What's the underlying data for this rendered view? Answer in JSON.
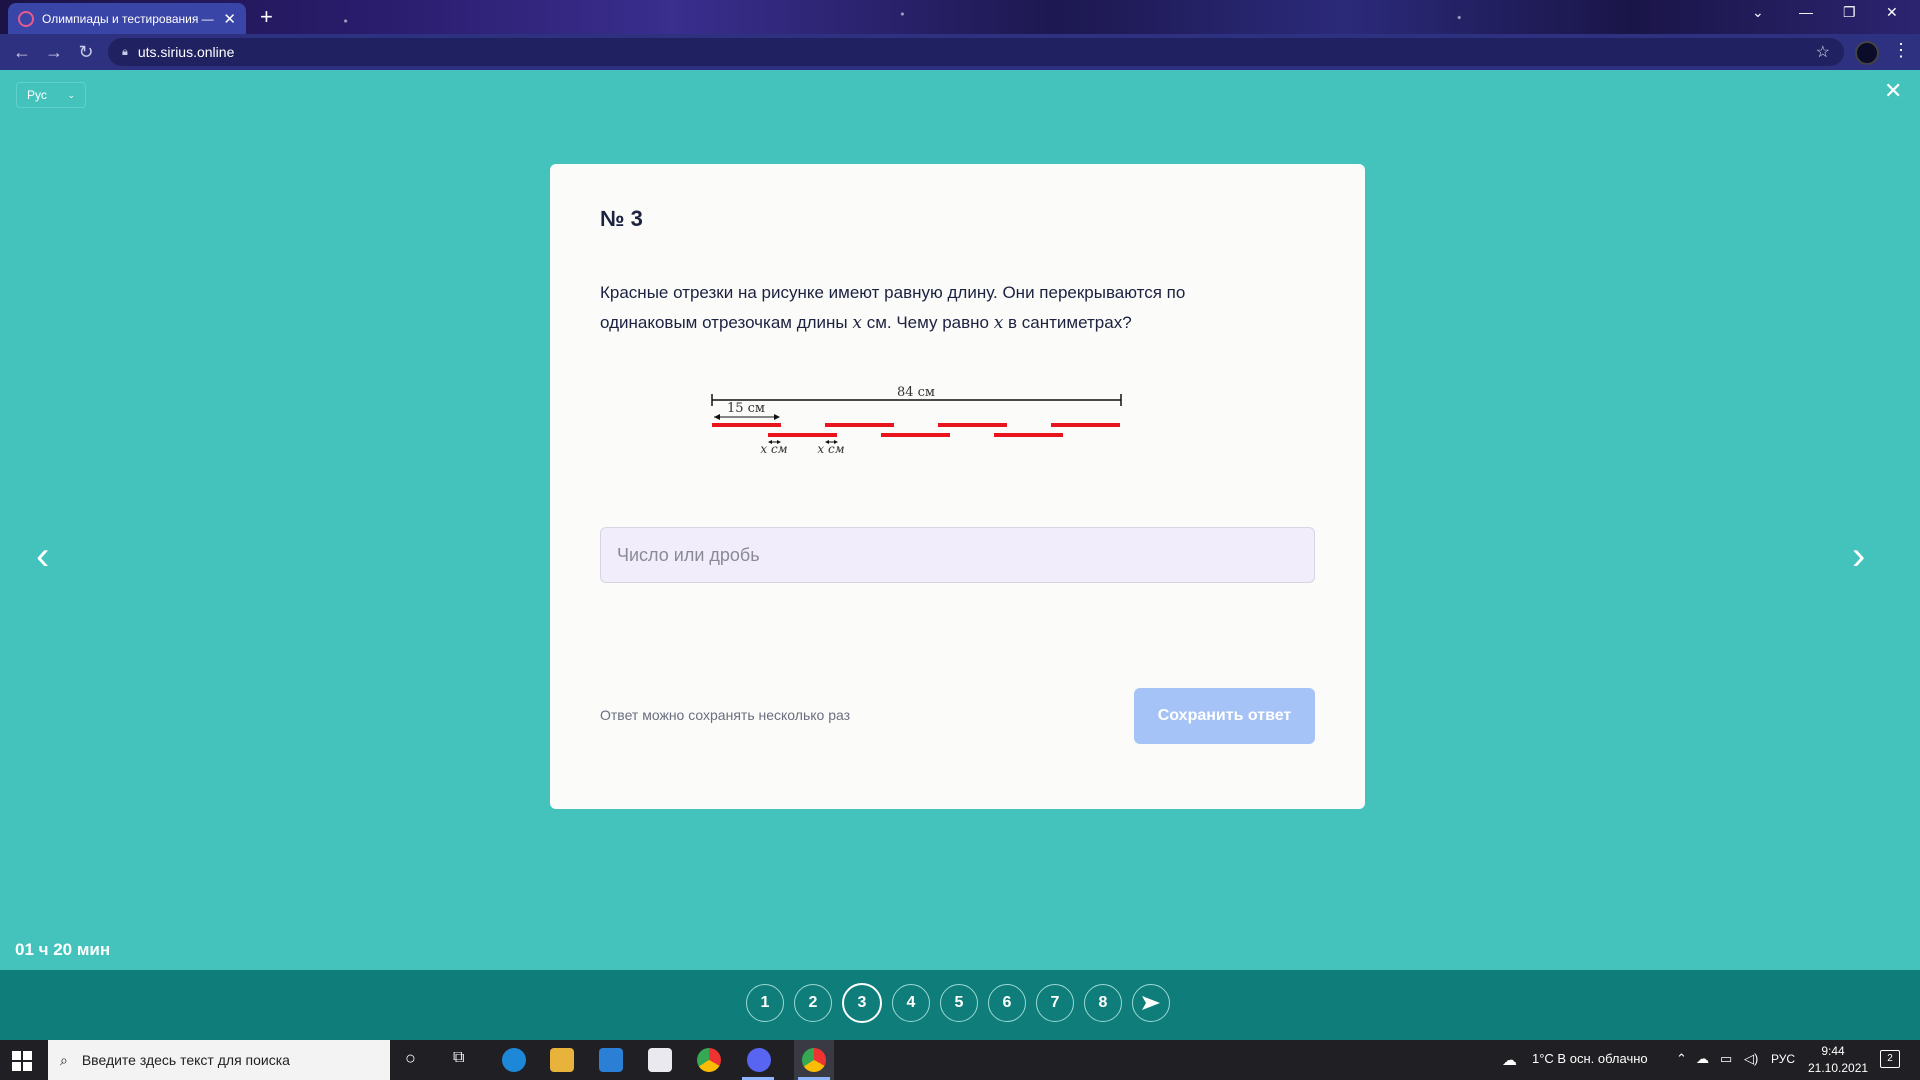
{
  "browser": {
    "tab_title": "Олимпиады и тестирования — ",
    "tab_close": "✕",
    "new_tab": "+",
    "url": "uts.sirius.online"
  },
  "page": {
    "language": "Рус",
    "timer": "01 ч 20 мин"
  },
  "question": {
    "number": "№ 3",
    "text_part1": "Красные отрезки на рисунке имеют равную длину. Они перекрываются по одинаковым отрезочкам длины ",
    "var1": "x",
    "text_part2": " см. Чему равно ",
    "var2": "x",
    "text_part3": " в сантиметрах?",
    "answer_placeholder": "Число или дробь",
    "hint": "Ответ можно сохранять несколько раз",
    "save_button": "Сохранить ответ"
  },
  "diagram": {
    "total_label": "84 см",
    "segment_label": "15 см",
    "overlap_label_1": "x см",
    "overlap_label_2": "x см",
    "segment_color": "#e8141e"
  },
  "pager": {
    "pages": [
      "1",
      "2",
      "3",
      "4",
      "5",
      "6",
      "7",
      "8"
    ],
    "current": "3"
  },
  "taskbar": {
    "search_placeholder": "Введите здесь текст для поиска",
    "weather": "1°C  В осн. облачно",
    "language": "РУС",
    "time": "9:44",
    "date": "21.10.2021",
    "notifications": "2"
  },
  "colors": {
    "page_background": "#44c3bd",
    "nav_bar": "#0f7e7b",
    "save_button": "#a6c3f7",
    "answer_field": "#f1edfa"
  }
}
